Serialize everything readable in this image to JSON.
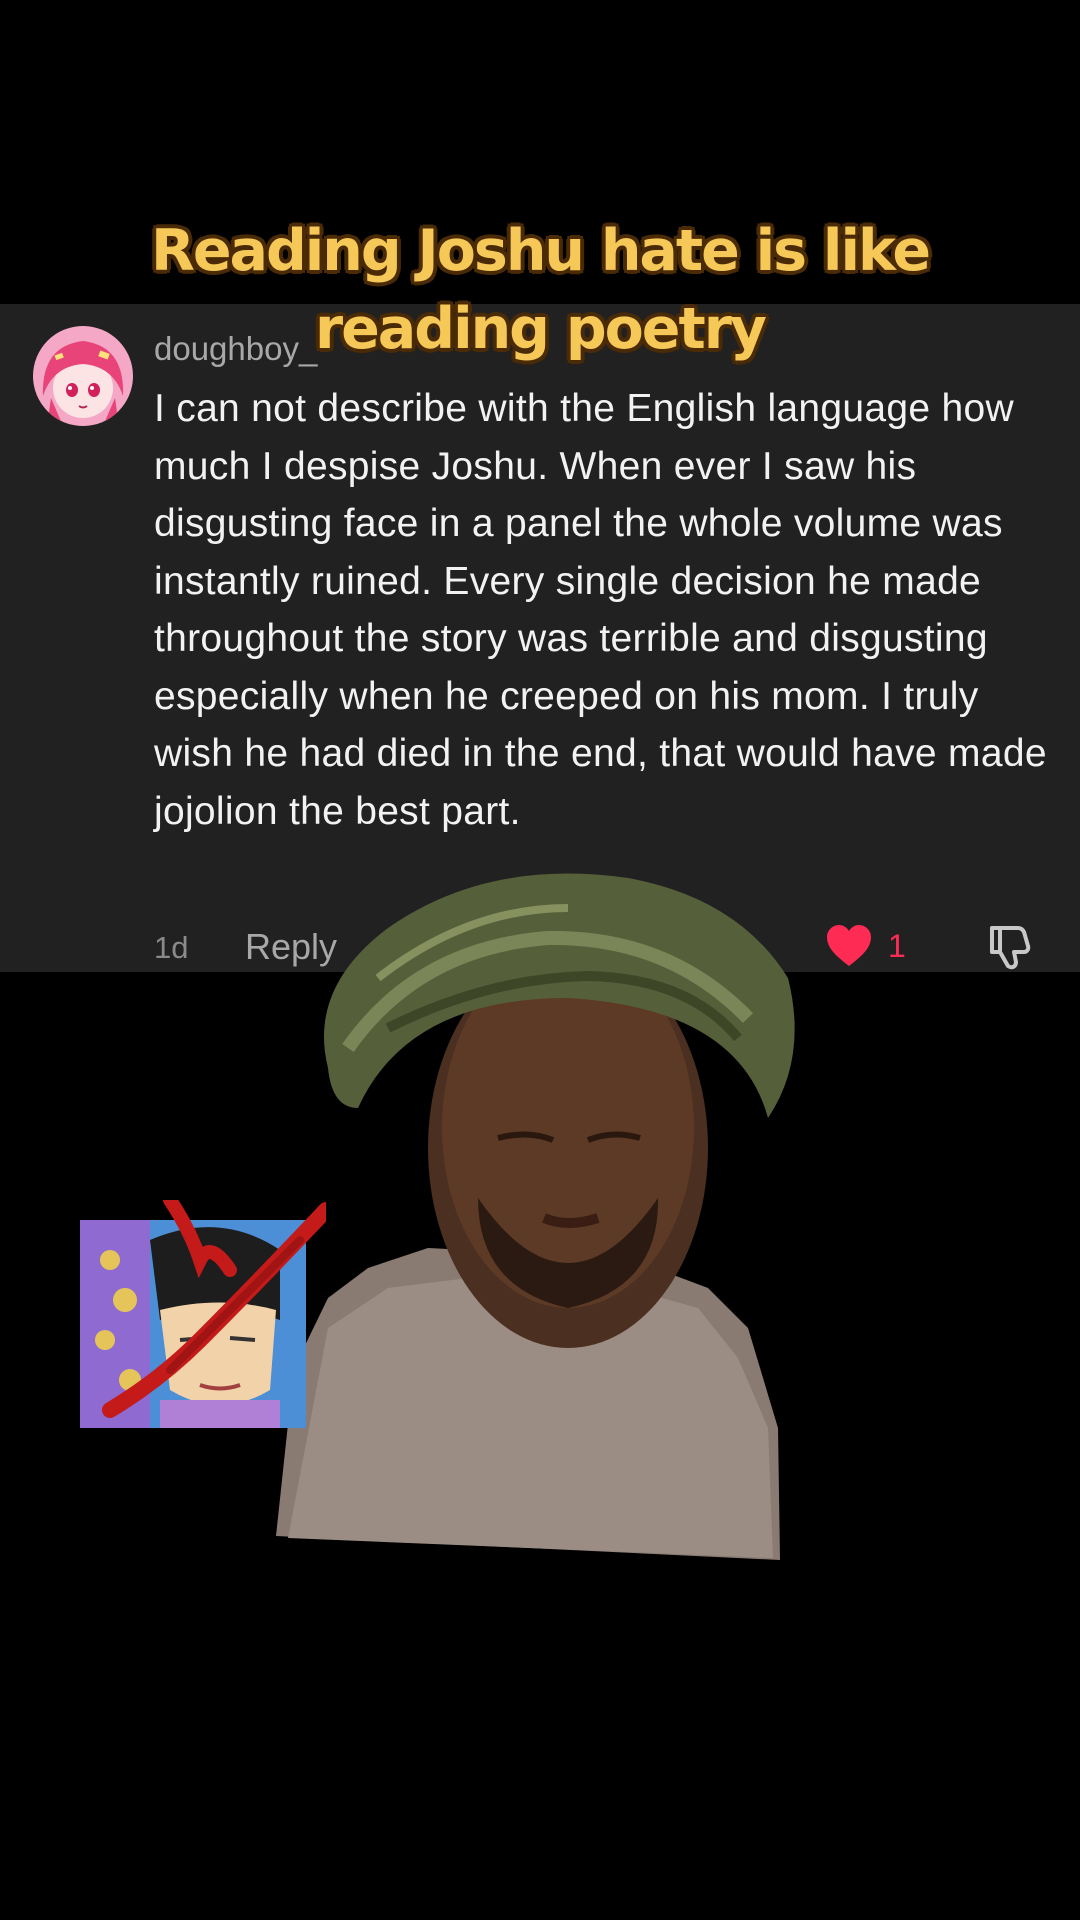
{
  "caption": {
    "line1": "Reading Joshu hate is like",
    "line2": "reading poetry"
  },
  "comment": {
    "username": "doughboy_",
    "avatar_icon": "anime-avatar-icon",
    "text": "I can not describe with the English language how much I despise Joshu. When ever I saw his disgusting face in a panel the whole volume was instantly ruined. Every single decision he made throughout the story was terrible and disgusting especially when he creeped on his mom. I truly wish he had died in the end, that would have made jojolion the best part.",
    "time": "1d",
    "reply_label": "Reply",
    "like_count": "1",
    "like_icon": "heart-icon",
    "dislike_icon": "thumbs-down-icon",
    "like_color": "#fe2c55"
  },
  "overlays": {
    "person_image": "man-in-bonnet-photo",
    "sticker_image": "crossed-out-character-sticker"
  }
}
